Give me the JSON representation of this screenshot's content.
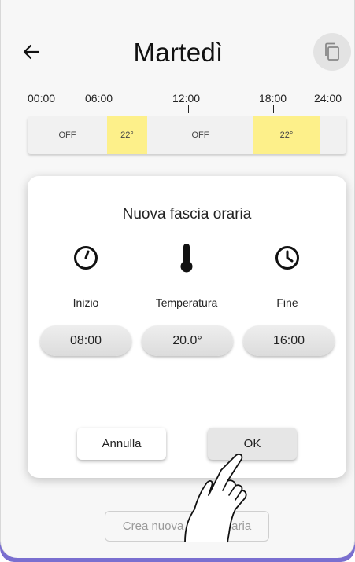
{
  "header": {
    "back_icon": "arrow-left-icon",
    "title": "Martedì",
    "copy_icon": "copy-icon"
  },
  "timeline": {
    "labels": [
      "00:00",
      "06:00",
      "12:00",
      "18:00",
      "24:00"
    ],
    "segments": [
      {
        "label": "OFF",
        "active": false
      },
      {
        "label": "22°",
        "active": true
      },
      {
        "label": "OFF",
        "active": false
      },
      {
        "label": "22°",
        "active": true
      },
      {
        "label": "",
        "active": false
      }
    ],
    "active_color": "#fdf08a"
  },
  "dialog": {
    "title": "Nuova fascia oraria",
    "start": {
      "icon": "clock-start-icon",
      "label": "Inizio",
      "value": "08:00"
    },
    "temperature": {
      "icon": "thermometer-icon",
      "label": "Temperatura",
      "value": "20.0°"
    },
    "end": {
      "icon": "clock-end-icon",
      "label": "Fine",
      "value": "16:00"
    },
    "cancel_label": "Annulla",
    "ok_label": "OK"
  },
  "footer": {
    "create_label": "Crea nuova fascia oraria"
  },
  "colors": {
    "accent": "#7a6fd0",
    "highlight": "#fdf08a"
  }
}
